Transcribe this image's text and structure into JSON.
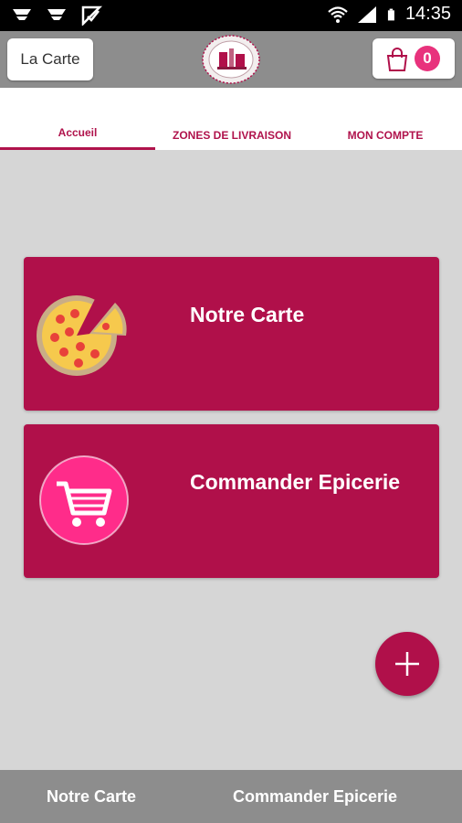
{
  "status_bar": {
    "time": "14:35",
    "icons": [
      "notification-icon",
      "notification-icon",
      "check-icon",
      "wifi-icon",
      "signal-icon",
      "battery-icon"
    ]
  },
  "header": {
    "carte_button_label": "La Carte",
    "logo_icon": "restaurant-logo",
    "cart_icon": "shopping-bag-icon",
    "cart_count": "0"
  },
  "tabs": [
    {
      "label": "Accueil",
      "active": true
    },
    {
      "label": "ZONES DE LIVRAISON",
      "active": false
    },
    {
      "label": "MON COMPTE",
      "active": false
    }
  ],
  "cards": [
    {
      "title": "Notre Carte",
      "icon": "pizza-icon"
    },
    {
      "title": "Commander Epicerie",
      "icon": "shopping-cart-icon"
    }
  ],
  "fab": {
    "icon": "plus-icon"
  },
  "bottom_nav": [
    {
      "label": "Notre Carte"
    },
    {
      "label": "Commander Epicerie"
    }
  ],
  "colors": {
    "accent": "#b0104a",
    "badge": "#e8327c",
    "header": "#8d8d8d",
    "background": "#d6d6d6"
  }
}
